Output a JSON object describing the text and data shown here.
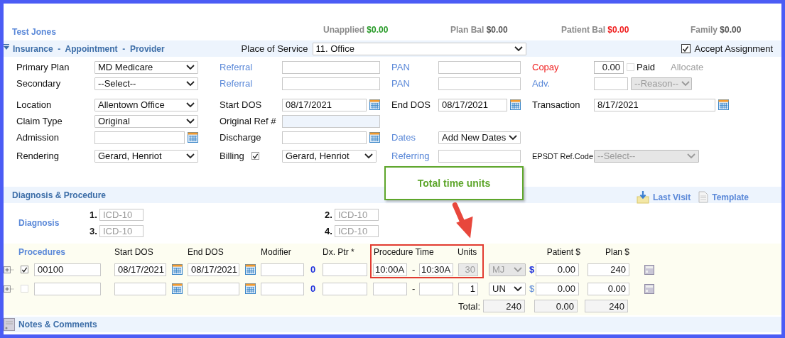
{
  "patient": {
    "name": "Test Jones"
  },
  "balances": [
    {
      "label": "Unapplied",
      "amount": "$0.00",
      "color": "#279a27"
    },
    {
      "label": "Plan Bal",
      "amount": "$0.00",
      "color": "#555555"
    },
    {
      "label": "Patient Bal",
      "amount": "$0.00",
      "color": "#f01e1e"
    },
    {
      "label": "Family",
      "amount": "$0.00",
      "color": "#555555"
    }
  ],
  "insurance_section": {
    "title": "Insurance  -  Appointment  -  Provider",
    "place_of_service": {
      "label": "Place of Service",
      "value": "11. Office"
    },
    "accept_assignment": {
      "label": "Accept Assignment",
      "checked": true
    }
  },
  "form_rows": [
    {
      "fields": [
        {
          "label": "Primary Plan",
          "kind": "plain",
          "controls": [
            {
              "kind": "select",
              "value": "MD Medicare",
              "disabled": false
            }
          ]
        },
        {
          "label": "Referral",
          "kind": "link",
          "controls": [
            {
              "kind": "input",
              "readonly": false
            }
          ]
        },
        {
          "label": "PAN",
          "kind": "link",
          "controls": [
            {
              "kind": "input",
              "readonly": false
            }
          ]
        },
        {
          "label": "Copay",
          "kind": "alert",
          "controls": [
            {
              "kind": "amount",
              "value": "0.00"
            },
            {
              "kind": "checkbox",
              "checked": false,
              "text": "Paid"
            },
            {
              "kind": "note",
              "text": "Allocate"
            }
          ]
        }
      ]
    },
    {
      "fields": [
        {
          "label": "Secondary",
          "kind": "plain",
          "controls": [
            {
              "kind": "select",
              "value": "--Select--",
              "disabled": false
            }
          ]
        },
        {
          "label": "Referral",
          "kind": "link",
          "controls": [
            {
              "kind": "input",
              "readonly": false
            }
          ]
        },
        {
          "label": "PAN",
          "kind": "link",
          "controls": [
            {
              "kind": "input",
              "readonly": false
            }
          ]
        },
        {
          "label": "Adv.",
          "kind": "link",
          "controls": [
            {
              "kind": "short"
            },
            {
              "kind": "select",
              "value": "--Reason--",
              "disabled": true
            }
          ]
        }
      ]
    },
    {
      "fields": [
        {
          "label": "Location",
          "kind": "plain",
          "controls": [
            {
              "kind": "select",
              "value": "Allentown Office",
              "disabled": false
            }
          ]
        },
        {
          "label": "Start DOS",
          "kind": "plain",
          "controls": [
            {
              "kind": "date",
              "value": "08/17/2021"
            }
          ]
        },
        {
          "label": "End DOS",
          "kind": "plain",
          "controls": [
            {
              "kind": "date",
              "value": "08/17/2021"
            }
          ]
        },
        {
          "label": "Transaction",
          "kind": "plain",
          "controls": [
            {
              "kind": "date",
              "value": "8/17/2021"
            }
          ]
        }
      ]
    },
    {
      "fields": [
        {
          "label": "Claim Type",
          "kind": "plain",
          "controls": [
            {
              "kind": "select",
              "value": "Original",
              "disabled": false
            }
          ]
        },
        {
          "label": "Original Ref #",
          "kind": "plain",
          "controls": [
            {
              "kind": "input",
              "readonly": true
            }
          ]
        }
      ]
    },
    {
      "fields": [
        {
          "label": "Admission",
          "kind": "plain",
          "controls": [
            {
              "kind": "date"
            }
          ]
        },
        {
          "label": "Discharge",
          "kind": "plain",
          "controls": [
            {
              "kind": "date"
            }
          ]
        },
        {
          "label": "Dates",
          "kind": "link",
          "controls": [
            {
              "kind": "select",
              "value": "Add New Dates",
              "disabled": false
            }
          ]
        }
      ]
    },
    {
      "fields": [
        {
          "label": "Rendering",
          "kind": "plain",
          "controls": [
            {
              "kind": "select",
              "value": "Gerard, Henriot",
              "disabled": false
            }
          ]
        },
        {
          "label": "Billing",
          "kind": "plain",
          "label_check": true,
          "controls": [
            {
              "kind": "select",
              "value": "Gerard, Henriot",
              "disabled": false
            }
          ]
        },
        {
          "label": "Referring",
          "kind": "link",
          "controls": [
            {
              "kind": "input",
              "readonly": false
            }
          ]
        },
        {
          "label": "EPSDT Ref.Code",
          "kind": "compact",
          "controls": [
            {
              "kind": "select",
              "value": "--Select--",
              "disabled": true
            }
          ]
        }
      ]
    }
  ],
  "diagnosis_section": {
    "title": "Diagnosis & Procedure",
    "tools": [
      {
        "label": "Last Visit",
        "kind": "last-visit"
      },
      {
        "label": "Template",
        "kind": "template"
      }
    ],
    "diagnosis": {
      "label": "Diagnosis",
      "codes": [
        {
          "number": "1.",
          "placeholder": "ICD-10"
        },
        {
          "number": "2.",
          "placeholder": "ICD-10"
        },
        {
          "number": "3.",
          "placeholder": "ICD-10"
        },
        {
          "number": "4.",
          "placeholder": "ICD-10"
        }
      ]
    }
  },
  "procedures": {
    "title": "Procedures",
    "headers": {
      "start_dos": "Start DOS",
      "end_dos": "End DOS",
      "modifier": "Modifier",
      "pointer": "Dx. Ptr *",
      "time": "Procedure Time",
      "units": "Units",
      "patient": "Patient $",
      "plan": "Plan $"
    },
    "rows": [
      {
        "checked": true,
        "code": "00100",
        "start_dos": "08/17/2021",
        "end_dos": "08/17/2021",
        "pointer_count": "0",
        "time_start": "10:00A",
        "time_separator": "-",
        "time_end": "10:30A",
        "units": "30",
        "locked": true,
        "unit_type": "MJ",
        "currency": "$",
        "patient": "0.00",
        "plan": "240"
      },
      {
        "checked": false,
        "pointer_count": "0",
        "time_separator": "-",
        "units": "1",
        "locked": false,
        "unit_type": "UN",
        "currency": "$",
        "patient": "0.00",
        "plan": "0.00"
      }
    ],
    "totals": {
      "label": "Total:",
      "values": [
        "240",
        "0.00",
        "240"
      ]
    }
  },
  "notes_section": {
    "title": "Notes & Comments"
  },
  "callout": {
    "text": "Total time units"
  }
}
